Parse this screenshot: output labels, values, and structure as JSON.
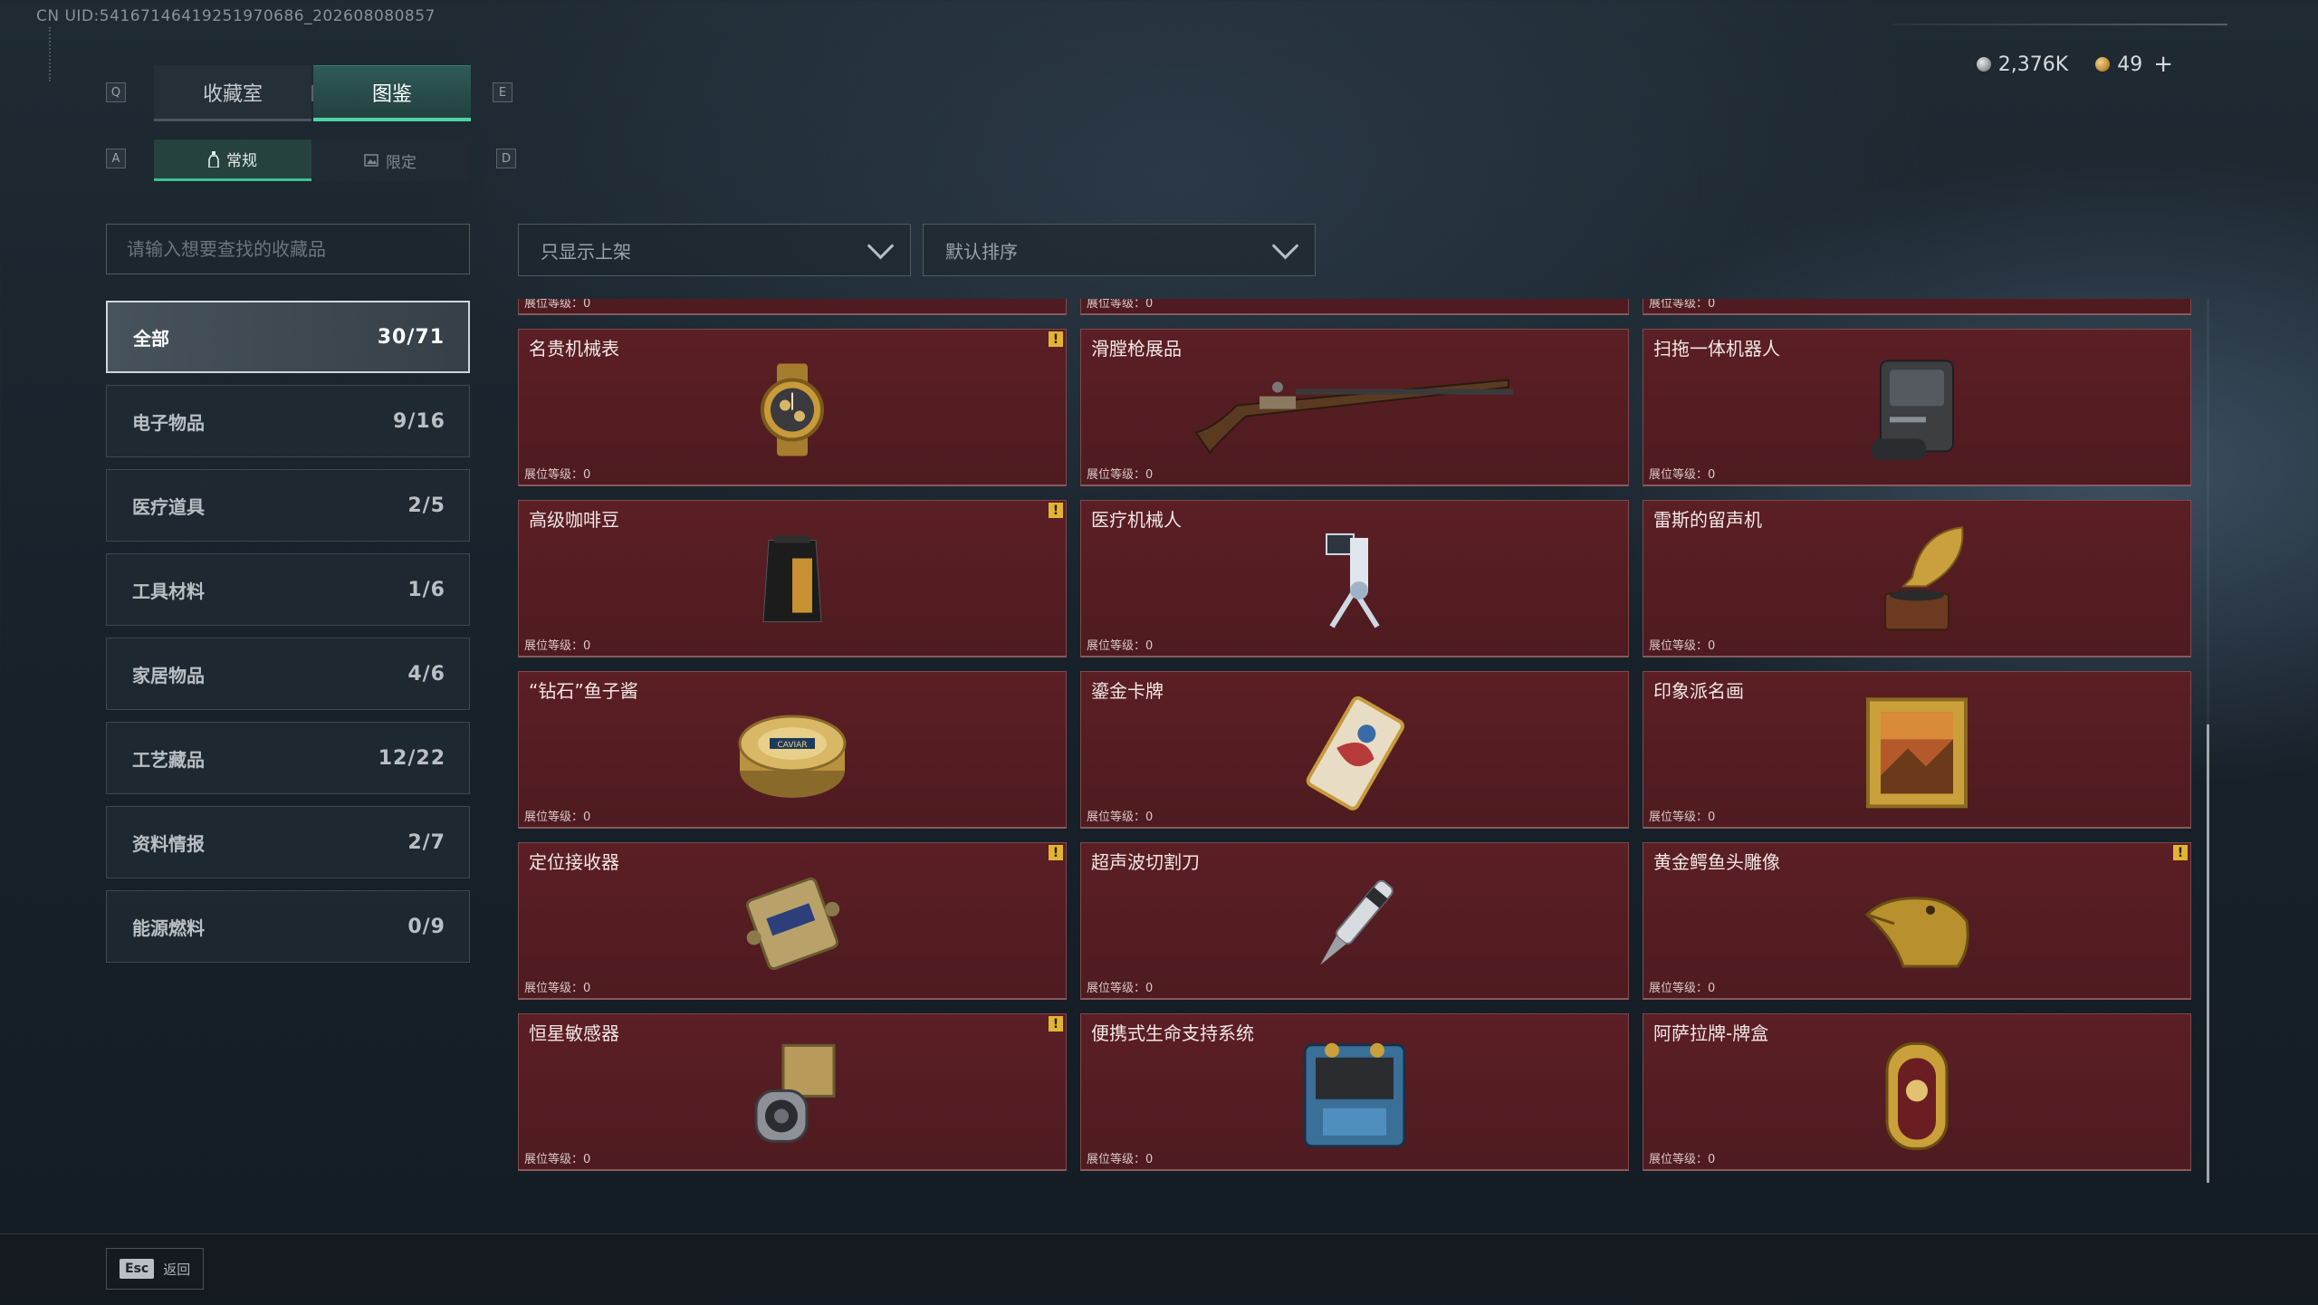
{
  "header": {
    "uid": "CN UID:5416714641925197​0686_202608080857",
    "currency": [
      {
        "value": "2,376K",
        "icon": "silver-coin-icon"
      },
      {
        "value": "49",
        "icon": "gold-coin-icon"
      }
    ],
    "add_label": "+"
  },
  "keys": {
    "prev_tab": "Q",
    "next_tab": "E",
    "prev_sub": "A",
    "next_sub": "D"
  },
  "tabs": [
    {
      "label": "收藏室",
      "active": false
    },
    {
      "label": "图鉴",
      "active": true
    }
  ],
  "subtabs": [
    {
      "label": "常规",
      "icon": "bottle-icon",
      "active": true
    },
    {
      "label": "限定",
      "icon": "image-icon",
      "active": false
    }
  ],
  "search": {
    "placeholder": "请输入想要查找的收藏品",
    "value": ""
  },
  "filters": {
    "shelf": "只显示上架",
    "sort": "默认排序"
  },
  "categories": [
    {
      "label": "全部",
      "count": "30/71",
      "active": true
    },
    {
      "label": "电子物品",
      "count": "9/16"
    },
    {
      "label": "医疗道具",
      "count": "2/5"
    },
    {
      "label": "工具材料",
      "count": "1/6"
    },
    {
      "label": "家居物品",
      "count": "4/6"
    },
    {
      "label": "工艺藏品",
      "count": "12/22"
    },
    {
      "label": "资料情报",
      "count": "2/7"
    },
    {
      "label": "能源燃料",
      "count": "0/9"
    }
  ],
  "level_label": "展位等级：0",
  "items": [
    {
      "name": "",
      "warn": false,
      "icon": "partial-item-icon"
    },
    {
      "name": "",
      "warn": false,
      "icon": "partial-item-icon"
    },
    {
      "name": "",
      "warn": false,
      "icon": "partial-item-icon"
    },
    {
      "name": "名贵机械表",
      "warn": true,
      "icon": "watch-icon"
    },
    {
      "name": "滑膛枪展品",
      "warn": false,
      "icon": "musket-icon"
    },
    {
      "name": "扫拖一体机器人",
      "warn": false,
      "icon": "robot-vacuum-icon"
    },
    {
      "name": "高级咖啡豆",
      "warn": true,
      "icon": "coffee-bag-icon"
    },
    {
      "name": "医疗机械人",
      "warn": false,
      "icon": "medical-robot-icon"
    },
    {
      "name": "雷斯的留声机",
      "warn": false,
      "icon": "gramophone-icon"
    },
    {
      "name": "“钻石”鱼子酱",
      "warn": false,
      "icon": "caviar-tin-icon"
    },
    {
      "name": "鎏金卡牌",
      "warn": false,
      "icon": "gilded-card-icon"
    },
    {
      "name": "印象派名画",
      "warn": false,
      "icon": "painting-icon"
    },
    {
      "name": "定位接收器",
      "warn": true,
      "icon": "receiver-icon"
    },
    {
      "name": "超声波切割刀",
      "warn": false,
      "icon": "ultrasonic-knife-icon"
    },
    {
      "name": "黄金鳄鱼头雕像",
      "warn": true,
      "icon": "crocodile-statue-icon"
    },
    {
      "name": "恒星敏感器",
      "warn": true,
      "icon": "star-sensor-icon"
    },
    {
      "name": "便携式生命支持系统",
      "warn": false,
      "icon": "life-support-icon"
    },
    {
      "name": "阿萨拉牌-牌盒",
      "warn": false,
      "icon": "card-box-icon"
    }
  ],
  "footer": {
    "esc_key": "Esc",
    "back_label": "返回"
  }
}
